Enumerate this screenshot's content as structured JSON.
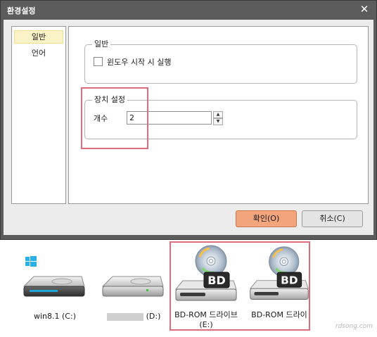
{
  "dialog": {
    "title": "환경설정",
    "close_glyph": "✕",
    "nav_items": [
      {
        "label": "일반",
        "selected": true
      },
      {
        "label": "언어",
        "selected": false
      }
    ],
    "general_group": {
      "label": "일반",
      "startup_checkbox_label": "윈도우 시작 시 실행",
      "startup_checked": false
    },
    "device_group": {
      "label": "장치 설정",
      "count_label": "개수",
      "count_value": "2"
    },
    "ok_label": "확인(O)",
    "cancel_label": "취소(C)"
  },
  "drives": [
    {
      "label": "win8.1 (C:)",
      "icon": "windows-drive-icon"
    },
    {
      "label": "(D:)",
      "icon": "hard-drive-icon"
    },
    {
      "label": "BD-ROM 드라이브 (E:)",
      "icon": "bd-rom-drive-icon",
      "badge": "BD"
    },
    {
      "label": "BD-ROM 드라이",
      "icon": "bd-rom-drive-icon",
      "badge": "BD"
    }
  ],
  "colors": {
    "titlebar": "#5c5c5c",
    "ok_button": "#f2a47c",
    "highlight_box": "#e06b7d",
    "selected_nav": "#fbf3c8",
    "windows_logo": "#29b0e8"
  }
}
